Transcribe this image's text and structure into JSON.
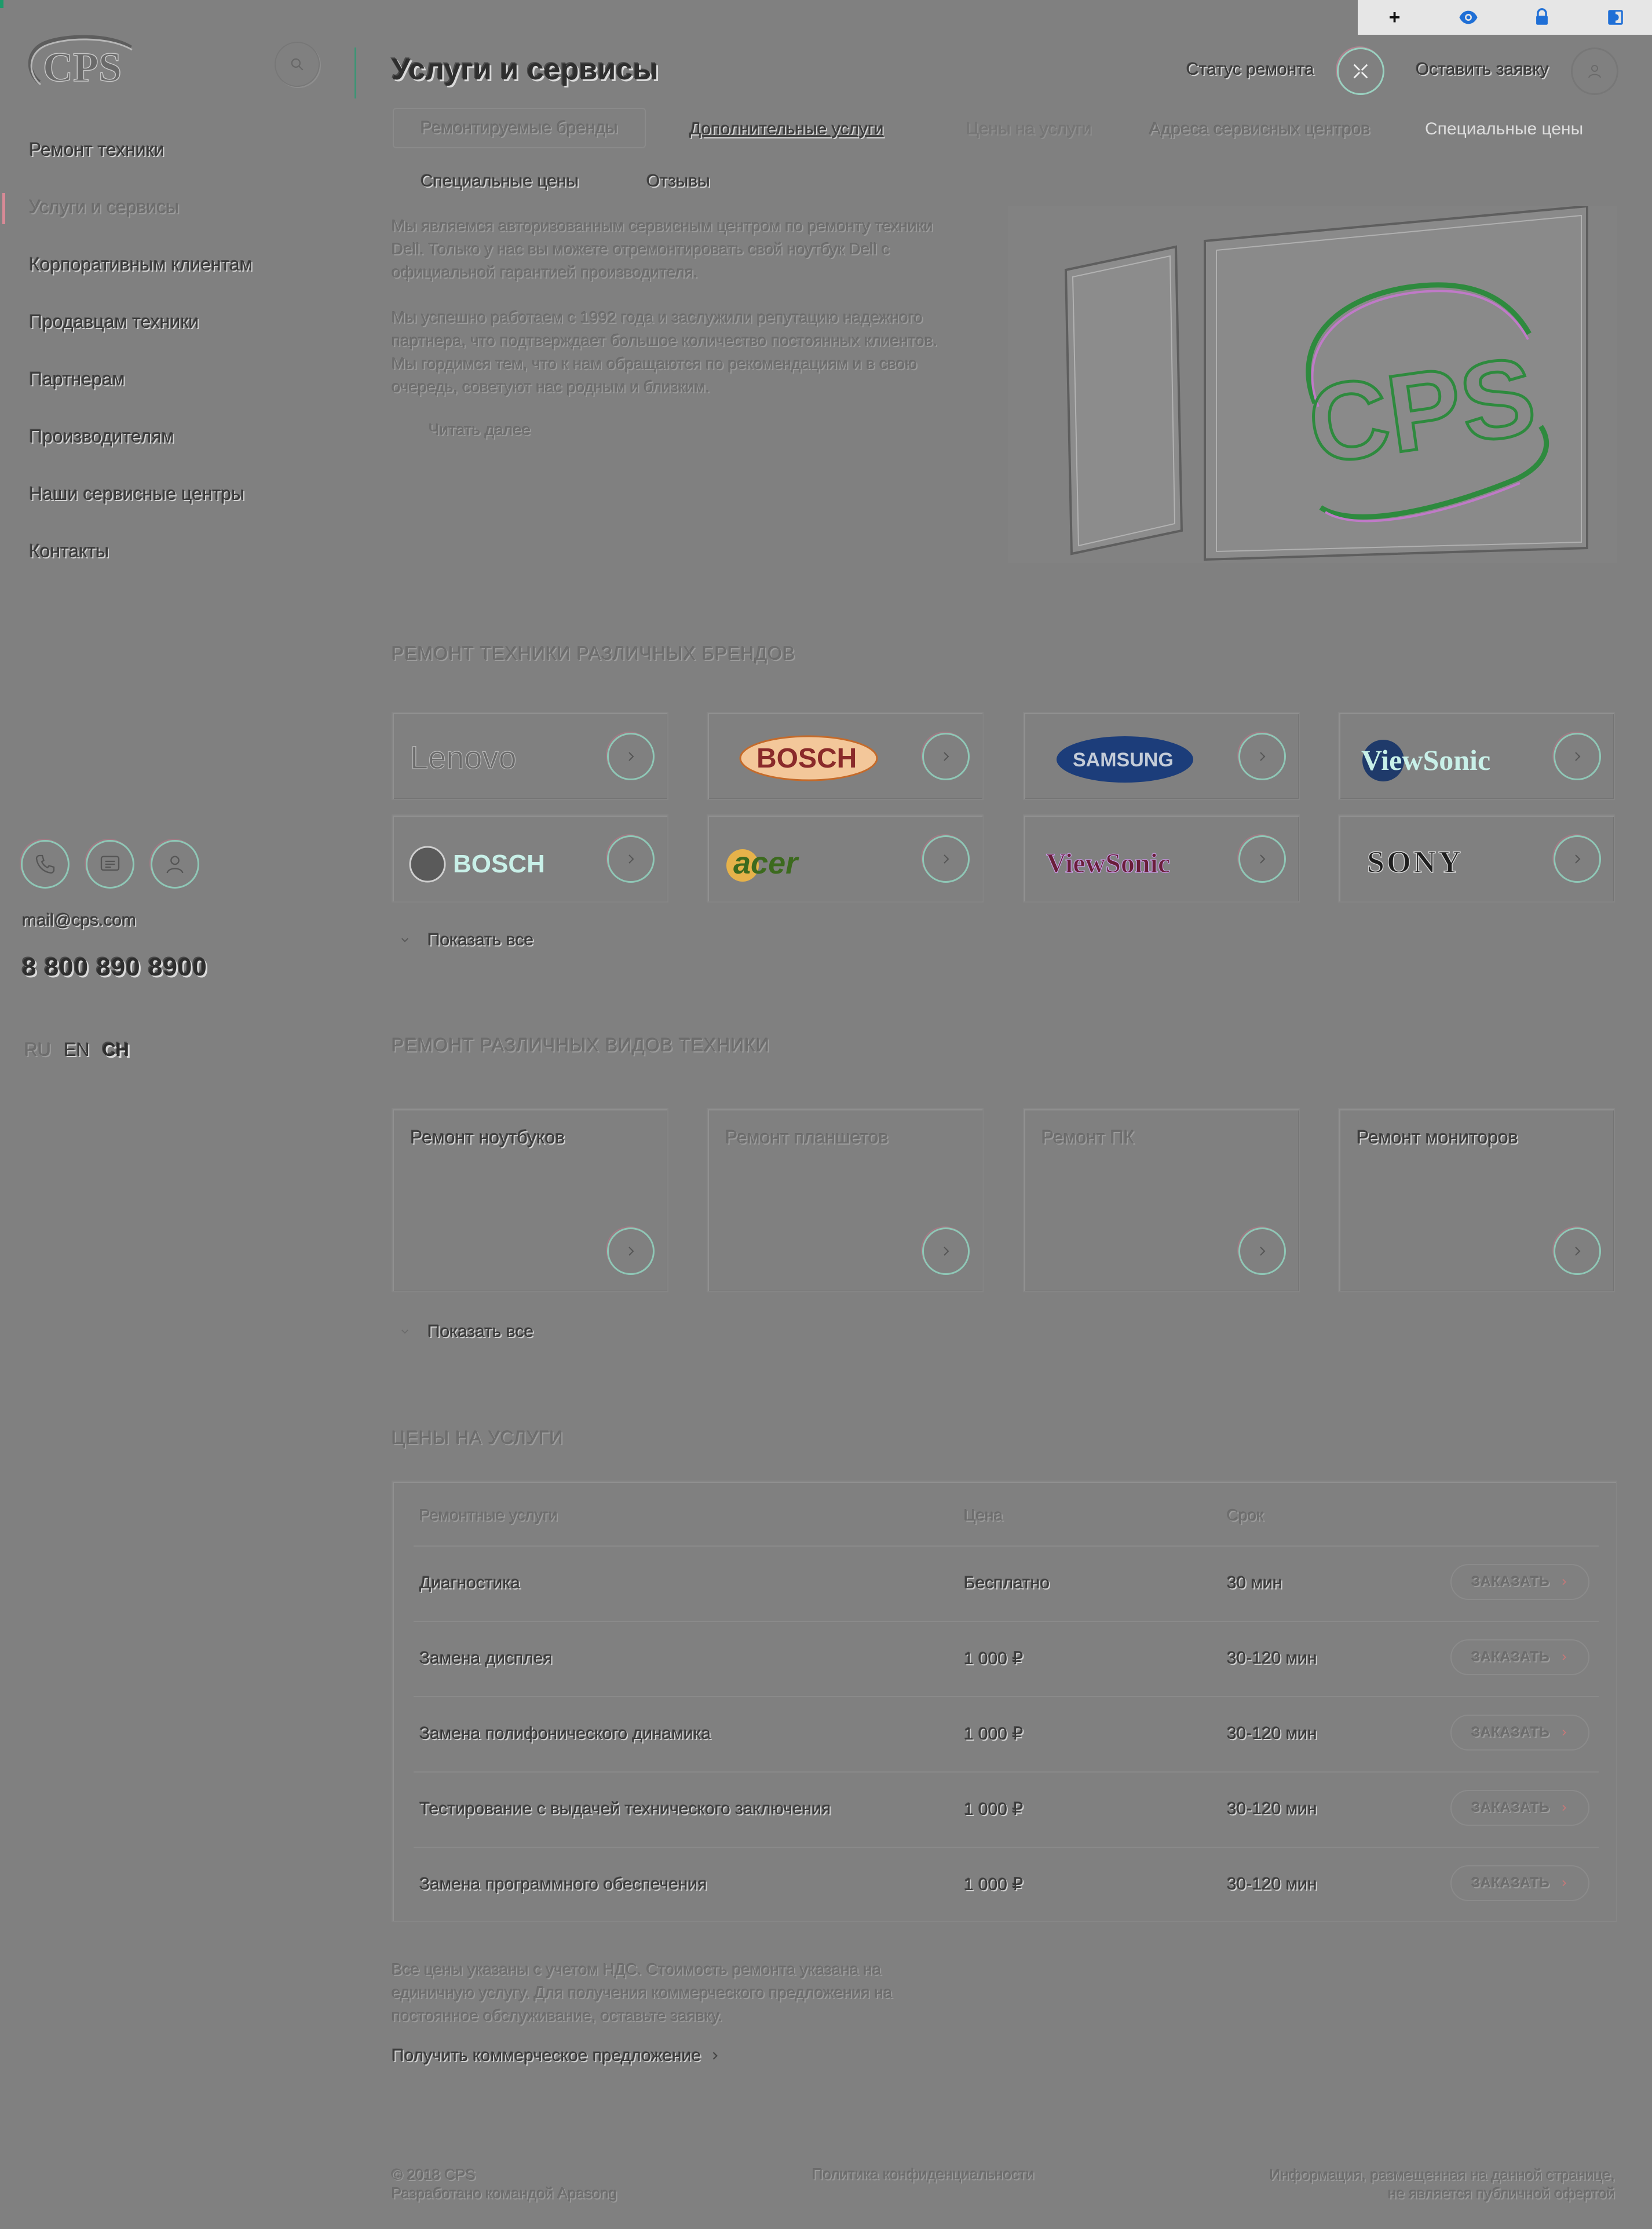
{
  "toolbar": {
    "items": [
      "+",
      "eye-icon",
      "lock-icon",
      "contrast-icon"
    ]
  },
  "brand": {
    "name": "CPS"
  },
  "sidebar": {
    "items": [
      {
        "label": "Ремонт техники"
      },
      {
        "label": "Услуги и сервисы"
      },
      {
        "label": "Корпоративным клиентам"
      },
      {
        "label": "Продавцам техники"
      },
      {
        "label": "Партнерам"
      },
      {
        "label": "Производителям"
      },
      {
        "label": "Наши сервисные центры"
      },
      {
        "label": "Контакты"
      }
    ],
    "email": "mail@cps.com",
    "phone": "8 800 890 8900",
    "languages": [
      "RU",
      "EN",
      "CH"
    ]
  },
  "header": {
    "title": "Услуги и сервисы",
    "status_link": "Статус ремонта",
    "order_link": "Оставить заявку"
  },
  "tabs": [
    {
      "label": "Ремонтируемые бренды"
    },
    {
      "label": "Дополнительные услуги"
    },
    {
      "label": "Цены на услуги"
    },
    {
      "label": "Адреса сервисных центров"
    },
    {
      "label": "Специальные цены"
    },
    {
      "label": "Специальные цены"
    },
    {
      "label": "Отзывы"
    }
  ],
  "intro": {
    "p1": "Мы являемся авторизованным сервисным центром по ремонту техники Dell. Только у нас вы можете отремонтировать свой ноутбук Dell с официальной гарантией производителя.",
    "p2": "Мы успешно работаем с 1992 года и заслужили репутацию надежного партнера, что подтверждает большое количество постоянных клиентов. Мы гордимся тем, что к нам обращаются по рекомендациям и в свою очередь, советуют нас родным и близким.",
    "read_more": "Читать далее"
  },
  "brands_section": {
    "title": "РЕМОНТ ТЕХНИКИ РАЗЛИЧНЫХ БРЕНДОВ",
    "brands": [
      "Lenovo",
      "BOSCH",
      "SAMSUNG",
      "ViewSonic",
      "BOSCH",
      "acer",
      "ViewSonic",
      "SONY"
    ],
    "show_all": "Показать все"
  },
  "types_section": {
    "title": "РЕМОНТ РАЗЛИЧНЫХ ВИДОВ ТЕХНИКИ",
    "types": [
      "Ремонт ноутбуков",
      "Ремонт планшетов",
      "Ремонт ПК",
      "Ремонт мониторов"
    ],
    "show_all": "Показать все"
  },
  "prices_section": {
    "title": "ЦЕНЫ НА УСЛУГИ",
    "columns": [
      "Ремонтные услуги",
      "Цена",
      "Срок"
    ],
    "rows": [
      {
        "service": "Диагностика",
        "price": "Бесплатно",
        "term": "30 мин"
      },
      {
        "service": "Замена дисплея",
        "price": "1 000 ₽",
        "term": "30-120 мин"
      },
      {
        "service": "Замена полифонического динамика",
        "price": "1 000 ₽",
        "term": "30-120 мин"
      },
      {
        "service": "Тестирование с выдачей технического заключения",
        "price": "1 000 ₽",
        "term": "30-120 мин"
      },
      {
        "service": "Замена программного обеспечения",
        "price": "1 000 ₽",
        "term": "30-120 мин"
      }
    ],
    "order_label": "ЗАКАЗАТЬ",
    "vat_note": "Все цены указаны с учетом НДС. Стоимость ремонта указана на единичную услугу. Для получения коммерческого предложения на постоянное обслуживание, оставьте заявку.",
    "offer_link": "Получить коммерческое предложение"
  },
  "footer": {
    "copyright": "© 2018 CPS",
    "developer": "Разработано командой Apasong",
    "privacy": "Политика конфиденциальности",
    "disclaimer_1": "Информация, размещенная на данной странице,",
    "disclaimer_2": "не является публичной офертой"
  },
  "colors": {
    "background": "#808080",
    "accent_green": "#2b9a72",
    "accent_pink": "#d88a96",
    "toolbar_bg": "#e6e6e6",
    "toolbar_icon": "#1f6fd6"
  }
}
